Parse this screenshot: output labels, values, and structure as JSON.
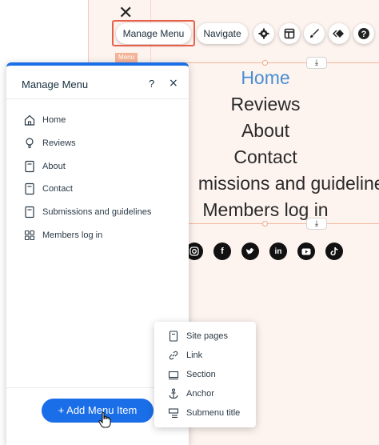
{
  "toolbar": {
    "manage_menu_label": "Manage Menu",
    "navigate_label": "Navigate",
    "icons": [
      "settings-icon",
      "layout-icon",
      "design-brush-icon",
      "animation-icon",
      "help-icon"
    ]
  },
  "canvas": {
    "element_tag": "Menu",
    "anchor_glyph": "⤓",
    "site_menu_items": [
      "Home",
      "Reviews",
      "About",
      "Contact",
      "Submissions and guidelines",
      "Members log in"
    ],
    "site_menu_item_visible_text": [
      "Home",
      "Reviews",
      "About",
      "Contact",
      "missions and guidelines",
      "Members log in"
    ],
    "active_item": "Home",
    "active_color": "#4a8fd1",
    "social_icons": [
      "instagram-icon",
      "facebook-icon",
      "twitter-icon",
      "linkedin-icon",
      "youtube-icon",
      "tiktok-icon"
    ]
  },
  "panel": {
    "title": "Manage Menu",
    "help": "?",
    "close": "×",
    "items": [
      {
        "label": "Home",
        "icon": "home-icon"
      },
      {
        "label": "Reviews",
        "icon": "lightbulb-icon"
      },
      {
        "label": "About",
        "icon": "page-icon"
      },
      {
        "label": "Contact",
        "icon": "page-icon"
      },
      {
        "label": "Submissions and guidelines",
        "icon": "page-icon"
      },
      {
        "label": "Members log in",
        "icon": "members-app-icon"
      }
    ],
    "add_button": "+ Add Menu Item",
    "accent_color": "#1a6ee8"
  },
  "dropdown": {
    "items": [
      {
        "label": "Site pages",
        "icon": "page-icon"
      },
      {
        "label": "Link",
        "icon": "link-icon"
      },
      {
        "label": "Section",
        "icon": "section-icon"
      },
      {
        "label": "Anchor",
        "icon": "anchor-icon"
      },
      {
        "label": "Submenu title",
        "icon": "submenu-icon"
      }
    ]
  }
}
